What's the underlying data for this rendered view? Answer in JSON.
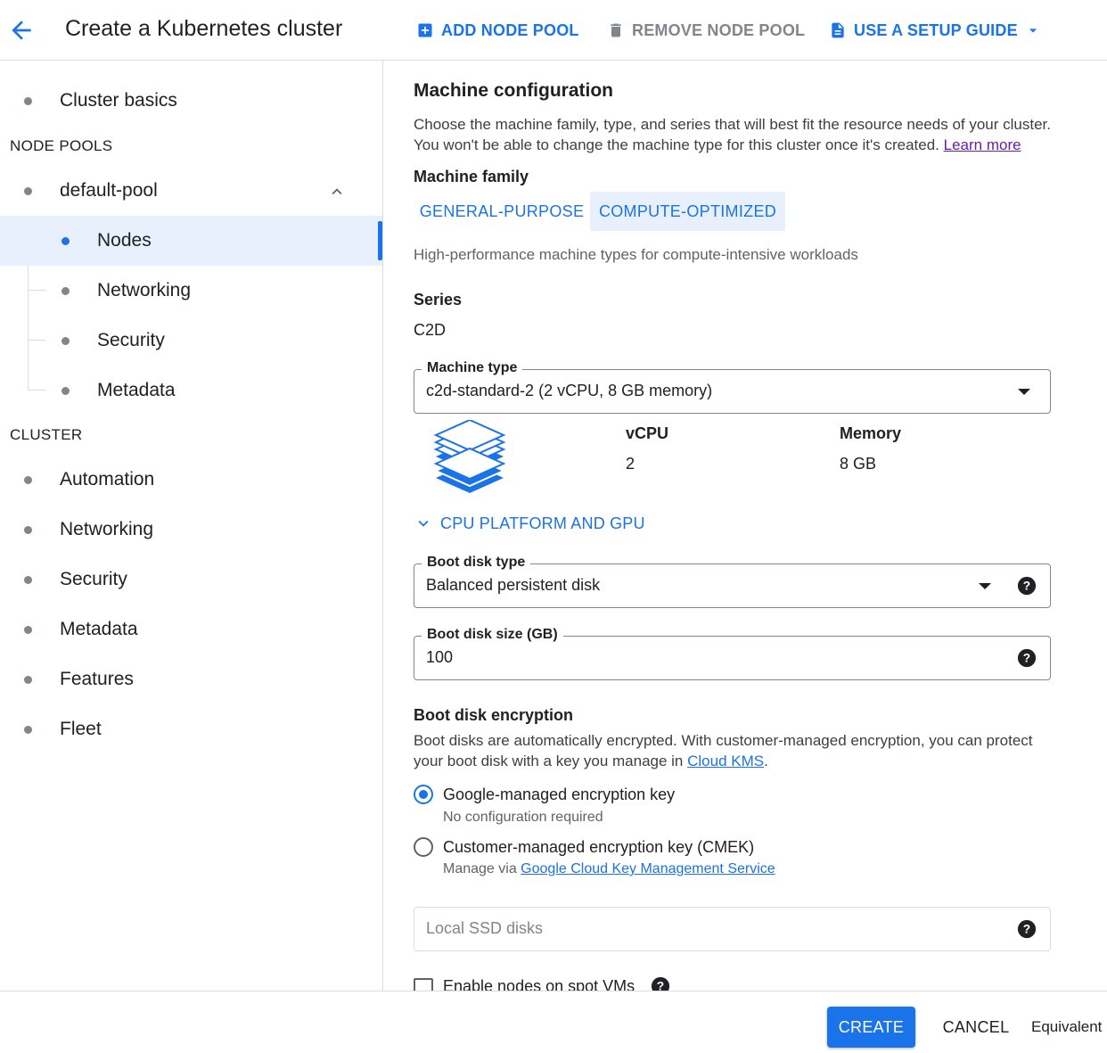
{
  "header": {
    "title": "Create a Kubernetes cluster",
    "add_node_pool": "ADD NODE POOL",
    "remove_node_pool": "REMOVE NODE POOL",
    "setup_guide": "USE A SETUP GUIDE"
  },
  "sidebar": {
    "cluster_basics": "Cluster basics",
    "node_pools_heading": "NODE POOLS",
    "pool_name": "default-pool",
    "pool_items": [
      "Nodes",
      "Networking",
      "Security",
      "Metadata"
    ],
    "active_item": "Nodes",
    "cluster_heading": "CLUSTER",
    "cluster_items": [
      "Automation",
      "Networking",
      "Security",
      "Metadata",
      "Features",
      "Fleet"
    ]
  },
  "main": {
    "title": "Machine configuration",
    "description": "Choose the machine family, type, and series that will best fit the resource needs of your cluster. You won't be able to change the machine type for this cluster once it's created.",
    "learn_more": "Learn more",
    "machine_family_label": "Machine family",
    "family_tabs": [
      "GENERAL-PURPOSE",
      "COMPUTE-OPTIMIZED"
    ],
    "selected_family": "COMPUTE-OPTIMIZED",
    "family_description": "High-performance machine types for compute-intensive workloads",
    "series_label": "Series",
    "series_value": "C2D",
    "machine_type_label": "Machine type",
    "machine_type_value": "c2d-standard-2 (2 vCPU, 8 GB memory)",
    "vcpu_label": "vCPU",
    "vcpu_value": "2",
    "memory_label": "Memory",
    "memory_value": "8 GB",
    "cpu_platform_toggle": "CPU PLATFORM AND GPU",
    "boot_disk_type_label": "Boot disk type",
    "boot_disk_type_value": "Balanced persistent disk",
    "boot_disk_size_label": "Boot disk size (GB)",
    "boot_disk_size_value": "100",
    "encryption_title": "Boot disk encryption",
    "encryption_description": "Boot disks are automatically encrypted. With customer-managed encryption, you can protect your boot disk with a key you manage in",
    "cloud_kms_link": "Cloud KMS",
    "radio_google_label": "Google-managed encryption key",
    "radio_google_sub": "No configuration required",
    "radio_cmek_label": "Customer-managed encryption key (CMEK)",
    "radio_cmek_sub_prefix": "Manage via",
    "radio_cmek_link": "Google Cloud Key Management Service",
    "selected_encryption": "Google-managed encryption key",
    "local_ssd_placeholder": "Local SSD disks",
    "spot_vms_label": "Enable nodes on spot VMs",
    "spot_vms_checked": false
  },
  "footer": {
    "create": "CREATE",
    "cancel": "CANCEL",
    "equivalent": "Equivalent"
  },
  "colors": {
    "accent": "#1a73e8",
    "active_bg": "#e8f0fe",
    "muted_text": "#5f6368",
    "border": "#dadce0"
  }
}
